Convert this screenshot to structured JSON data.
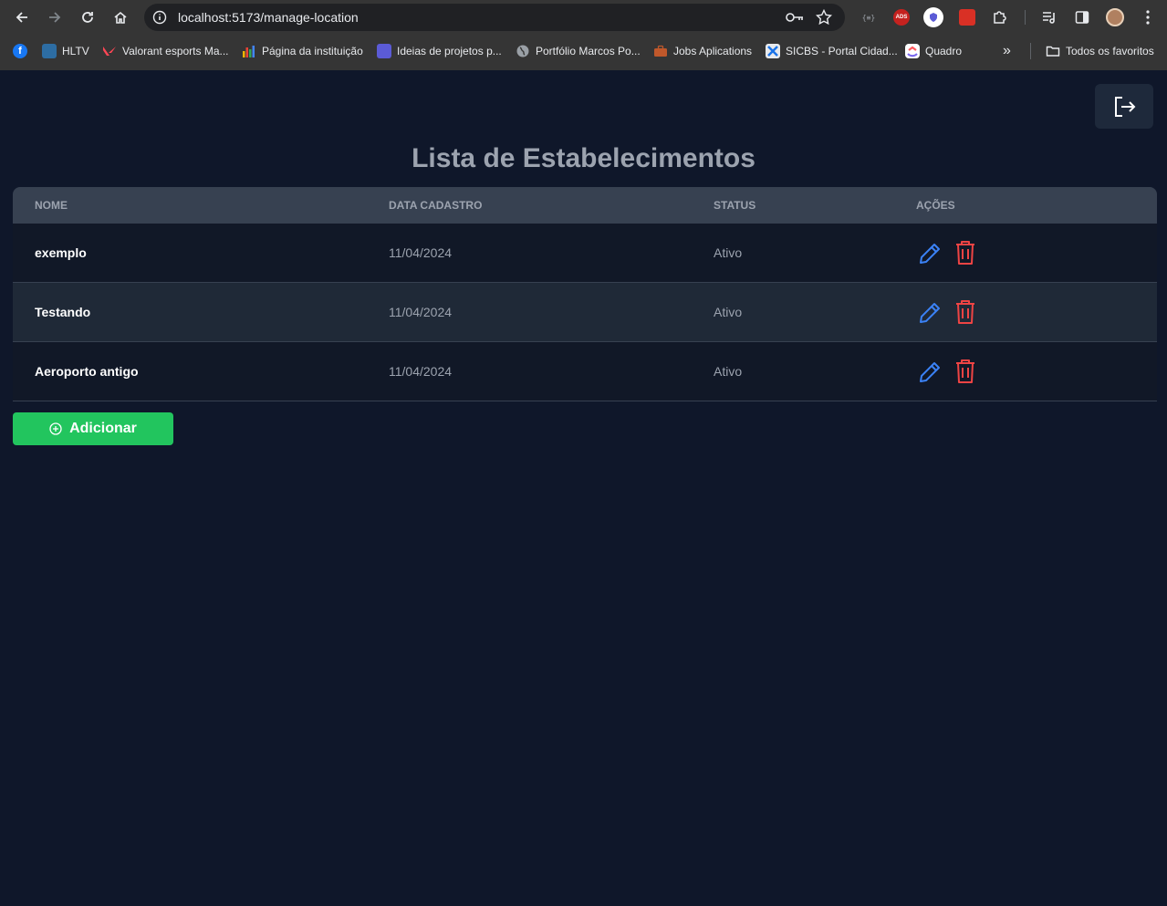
{
  "browser": {
    "url": "localhost:5173/manage-location",
    "bookmarks": [
      {
        "label": "",
        "icon": "facebook-icon",
        "color": "#1877f2"
      },
      {
        "label": "HLTV",
        "icon": "hltv-icon",
        "color": "#2d6da3"
      },
      {
        "label": "Valorant esports Ma...",
        "icon": "valorant-icon",
        "color": "#ff4655"
      },
      {
        "label": "Página da instituição",
        "icon": "bar-chart-icon",
        "color": "#f4b400"
      },
      {
        "label": "Ideias de projetos p...",
        "icon": "ideas-icon",
        "color": "#5b5bd6"
      },
      {
        "label": "Portfólio Marcos Po...",
        "icon": "globe-icon",
        "color": "#9aa0a6"
      },
      {
        "label": "Jobs Aplications",
        "icon": "briefcase-icon",
        "color": "#c0582b"
      },
      {
        "label": "SICBS - Portal Cidad...",
        "icon": "sicbs-icon",
        "color": "#e8eaed"
      },
      {
        "label": "Quadro",
        "icon": "clickup-icon",
        "color": "#7b68ee"
      }
    ],
    "more_label": "»",
    "all_bookmarks_label": "Todos os favoritos"
  },
  "page": {
    "title": "Lista de Estabelecimentos",
    "columns": [
      "NOME",
      "DATA CADASTRO",
      "STATUS",
      "AÇÕES"
    ],
    "rows": [
      {
        "name": "exemplo",
        "date": "11/04/2024",
        "status": "Ativo"
      },
      {
        "name": "Testando",
        "date": "11/04/2024",
        "status": "Ativo"
      },
      {
        "name": "Aeroporto antigo",
        "date": "11/04/2024",
        "status": "Ativo"
      }
    ],
    "add_button": "Adicionar"
  },
  "colors": {
    "background": "#0f172a",
    "header": "#374151",
    "edit": "#3b82f6",
    "delete": "#ef4444",
    "add": "#22c55e"
  }
}
